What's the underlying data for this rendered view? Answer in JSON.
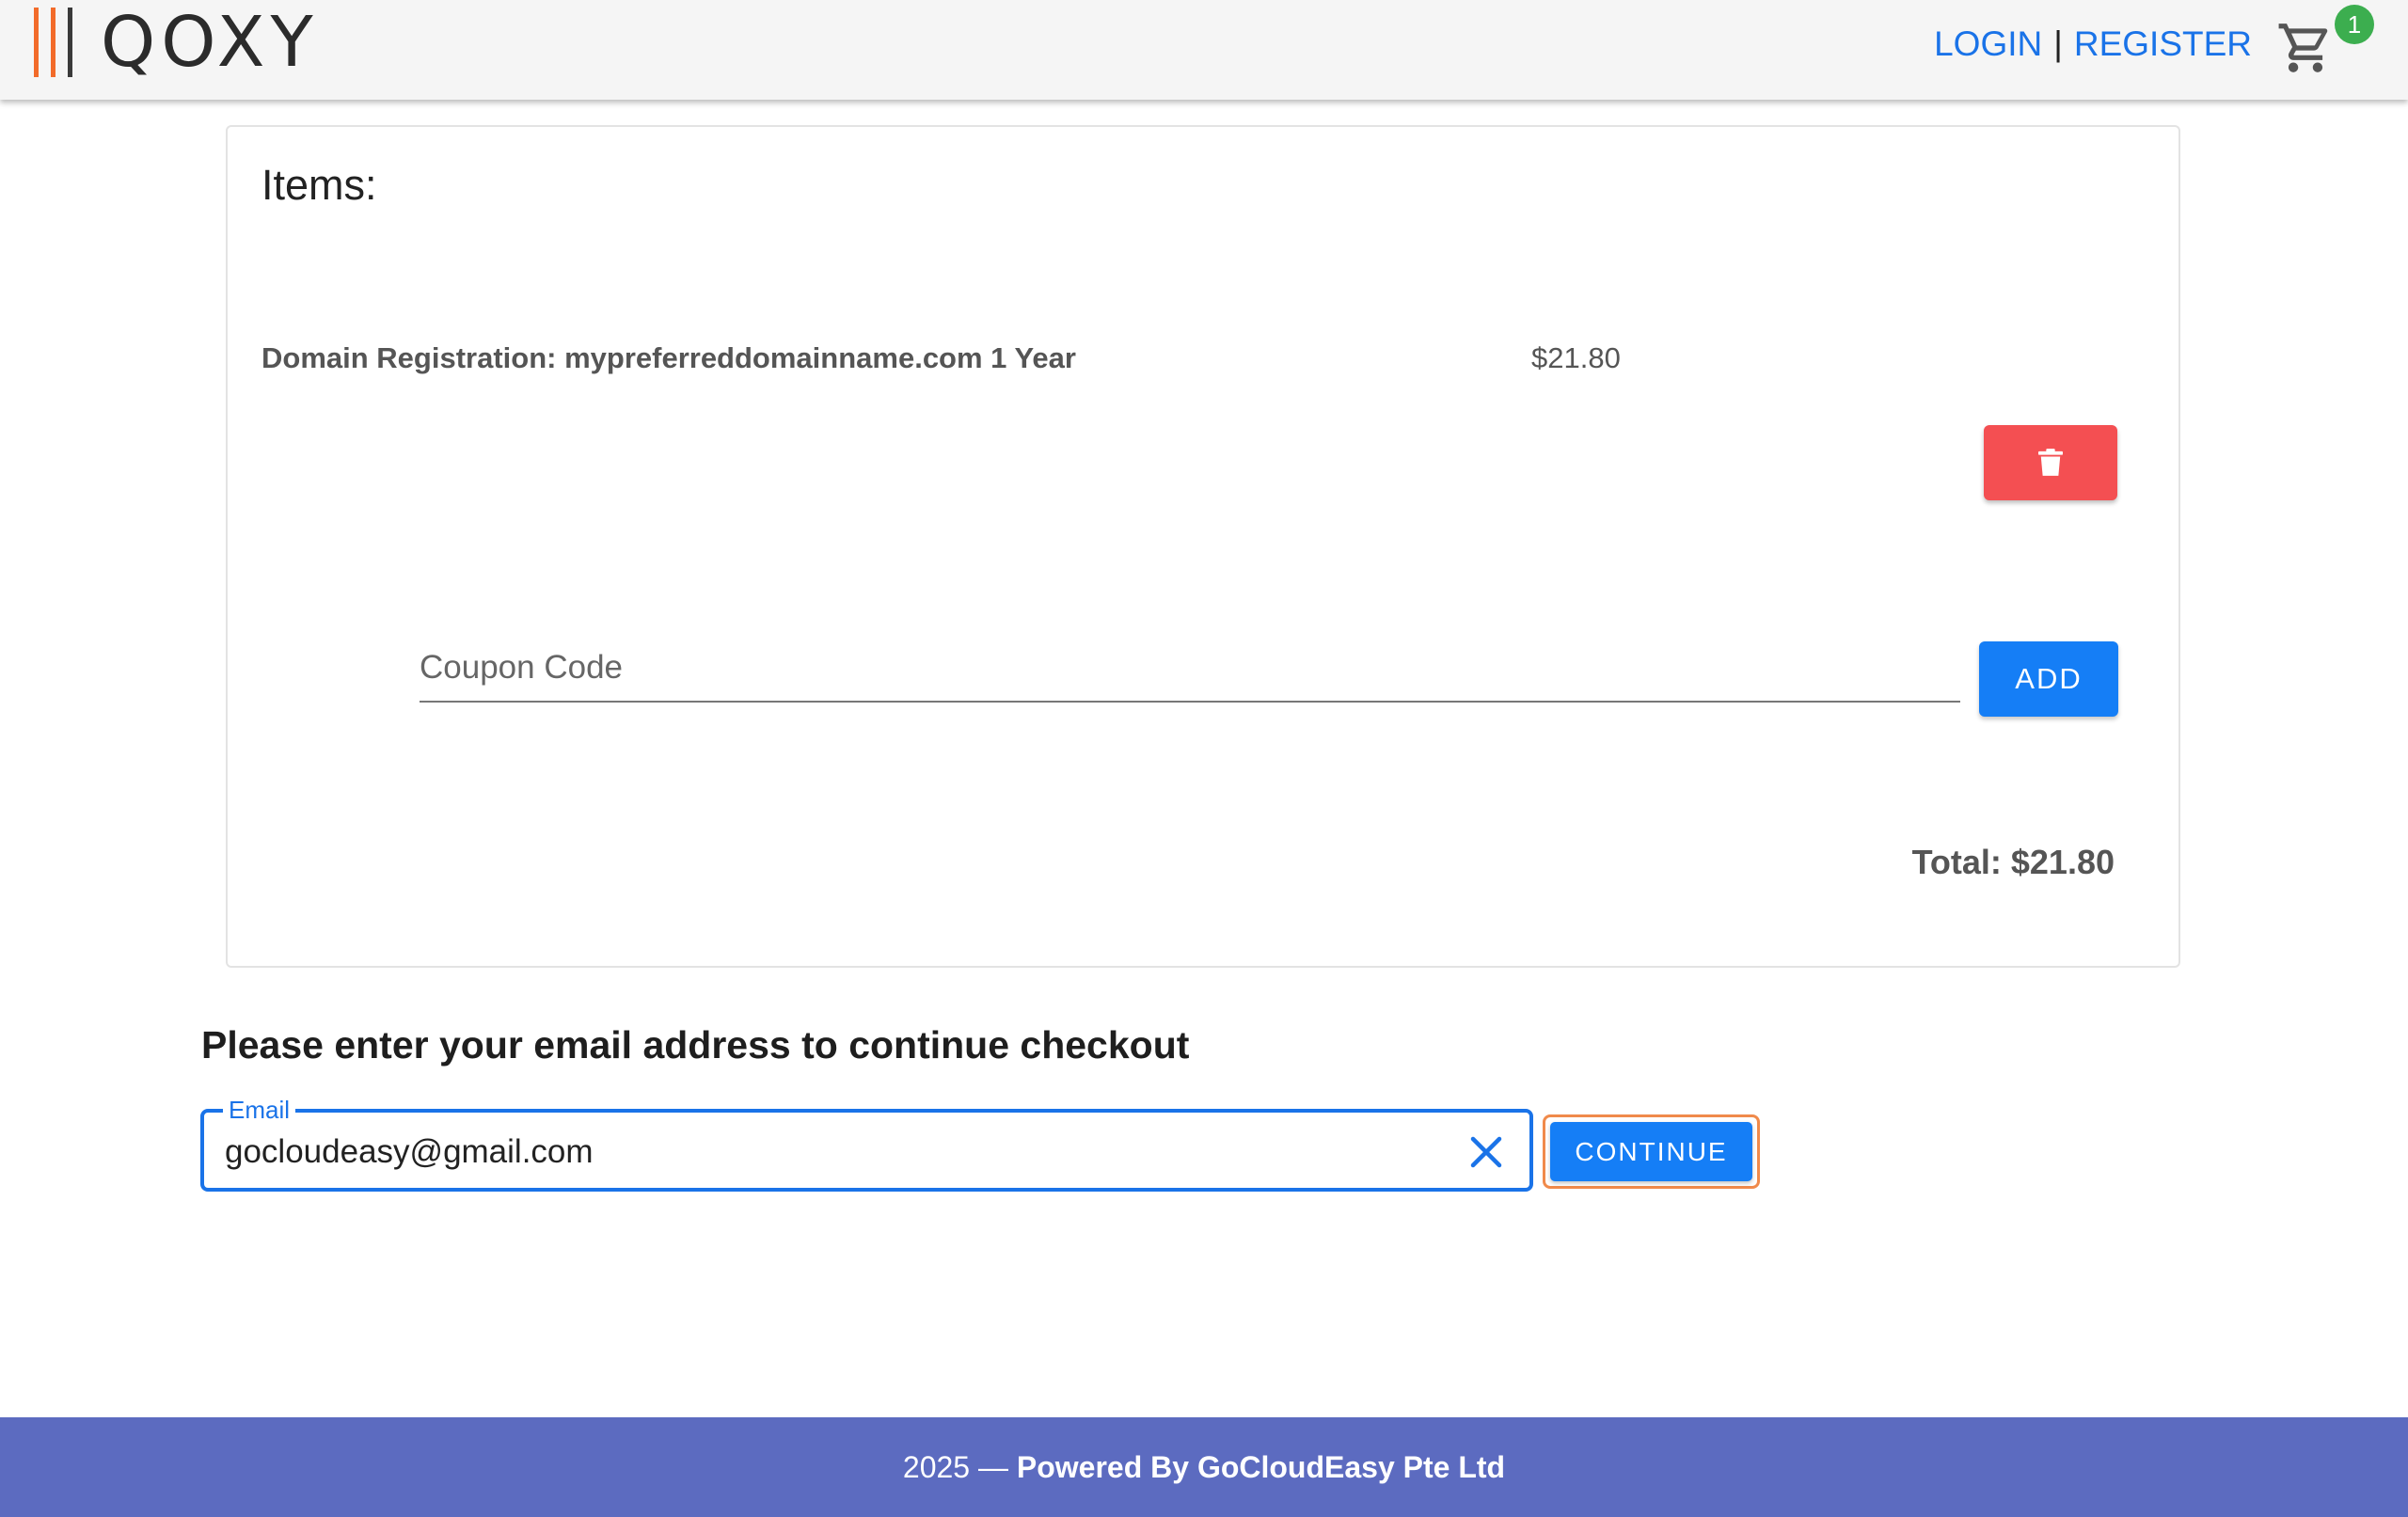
{
  "brand": {
    "name": "QOXY",
    "accent": "#f26b2a"
  },
  "nav": {
    "login": "LOGIN",
    "separator": "|",
    "register": "REGISTER",
    "cart_count": "1"
  },
  "cart": {
    "title": "Items:",
    "items": [
      {
        "name": "Domain Registration: mypreferreddomainname.com 1 Year",
        "price": "$21.80"
      }
    ],
    "coupon_placeholder": "Coupon Code",
    "add_label": "ADD",
    "total": "Total: $21.80"
  },
  "checkout": {
    "heading": "Please enter your email address to continue checkout",
    "email_label": "Email",
    "email_value": "gocloudeasy@gmail.com",
    "continue_label": "CONTINUE"
  },
  "footer": {
    "year_text": "2025 — ",
    "powered": "Powered By GoCloudEasy Pte Ltd"
  },
  "colors": {
    "primary": "#157ef6",
    "danger": "#f44f52",
    "footer": "#5c6bc0",
    "badge": "#3cae4f"
  },
  "icons": {
    "cart": "cart-icon",
    "delete": "trash-icon",
    "clear": "close-icon"
  }
}
